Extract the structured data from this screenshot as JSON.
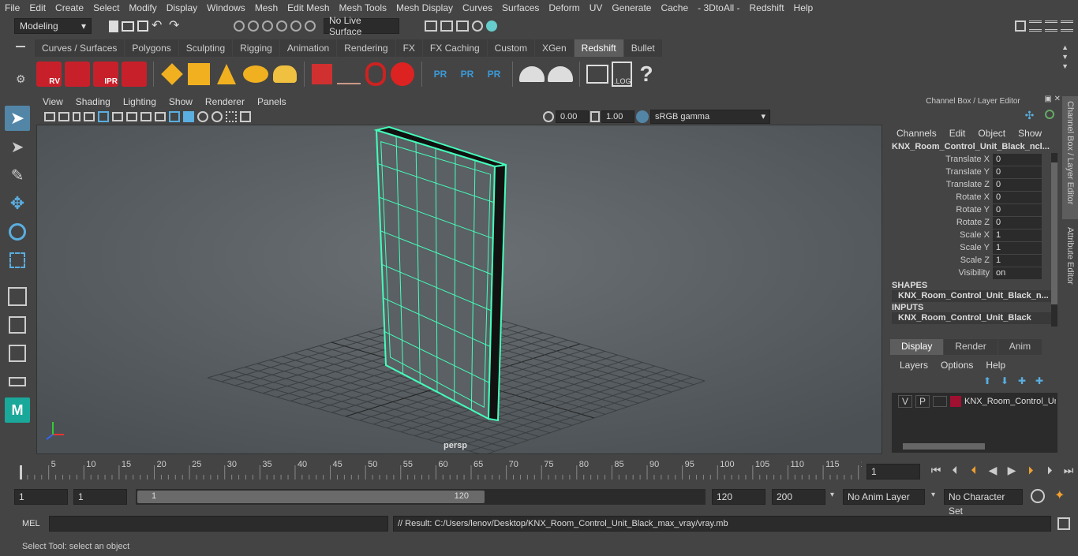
{
  "menu": [
    "File",
    "Edit",
    "Create",
    "Select",
    "Modify",
    "Display",
    "Windows",
    "Mesh",
    "Edit Mesh",
    "Mesh Tools",
    "Mesh Display",
    "Curves",
    "Surfaces",
    "Deform",
    "UV",
    "Generate",
    "Cache",
    "- 3DtoAll -",
    "Redshift",
    "Help"
  ],
  "status": {
    "workspace": "Modeling",
    "live_surface": "No Live Surface"
  },
  "shelf_tabs": [
    "Curves / Surfaces",
    "Polygons",
    "Sculpting",
    "Rigging",
    "Animation",
    "Rendering",
    "FX",
    "FX Caching",
    "Custom",
    "XGen",
    "Redshift",
    "Bullet"
  ],
  "shelf_active": "Redshift",
  "shelf_labels": {
    "rv": "RV",
    "ipr": "IPR",
    "pr": "PR",
    "log": ".LOG",
    "help": "?"
  },
  "viewport": {
    "menus": [
      "View",
      "Shading",
      "Lighting",
      "Show",
      "Renderer",
      "Panels"
    ],
    "exposure": "0.00",
    "gamma": "1.00",
    "colorspace": "sRGB gamma",
    "camera": "persp"
  },
  "channelbox": {
    "title": "Channel Box / Layer Editor",
    "menus": [
      "Channels",
      "Edit",
      "Object",
      "Show"
    ],
    "object": "KNX_Room_Control_Unit_Black_ncl...",
    "attrs": [
      {
        "n": "Translate X",
        "v": "0"
      },
      {
        "n": "Translate Y",
        "v": "0"
      },
      {
        "n": "Translate Z",
        "v": "0"
      },
      {
        "n": "Rotate X",
        "v": "0"
      },
      {
        "n": "Rotate Y",
        "v": "0"
      },
      {
        "n": "Rotate Z",
        "v": "0"
      },
      {
        "n": "Scale X",
        "v": "1"
      },
      {
        "n": "Scale Y",
        "v": "1"
      },
      {
        "n": "Scale Z",
        "v": "1"
      },
      {
        "n": "Visibility",
        "v": "on"
      }
    ],
    "shapes_label": "SHAPES",
    "shape": "KNX_Room_Control_Unit_Black_n...",
    "inputs_label": "INPUTS",
    "input": "KNX_Room_Control_Unit_Black"
  },
  "layer": {
    "tabs": [
      "Display",
      "Render",
      "Anim"
    ],
    "menus": [
      "Layers",
      "Options",
      "Help"
    ],
    "v": "V",
    "p": "P",
    "name": "KNX_Room_Control_Ur"
  },
  "side_tabs": [
    "Channel Box / Layer Editor",
    "Attribute Editor"
  ],
  "timeline": {
    "ticks": [
      "5",
      "10",
      "15",
      "20",
      "25",
      "30",
      "35",
      "40",
      "45",
      "50",
      "55",
      "60",
      "65",
      "70",
      "75",
      "80",
      "85",
      "90",
      "95",
      "100",
      "105",
      "110",
      "115",
      "12"
    ],
    "start": "1",
    "current": "1"
  },
  "range": {
    "start": "1",
    "start2": "1",
    "slider_start": "1",
    "slider_end": "120",
    "end": "120",
    "end2": "200",
    "anim_layer": "No Anim Layer",
    "char_set": "No Character Set"
  },
  "cmd": {
    "label": "MEL",
    "result": "// Result: C:/Users/lenov/Desktop/KNX_Room_Control_Unit_Black_max_vray/vray.mb"
  },
  "help": "Select Tool: select an object",
  "colors": {
    "accent": "#5285a6",
    "wire": "#44ffbb",
    "layer_color": "#a01030"
  }
}
